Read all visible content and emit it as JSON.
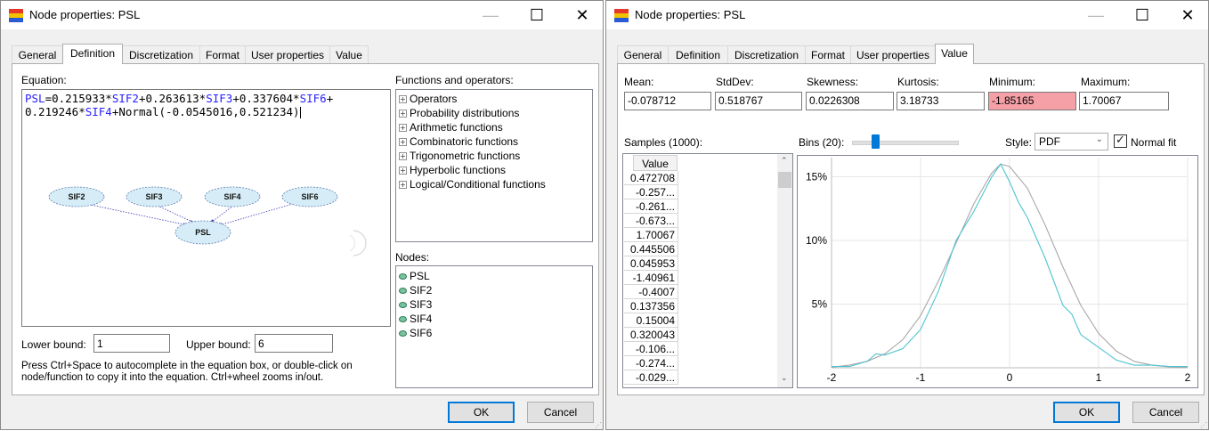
{
  "left_window": {
    "title": "Node properties: PSL",
    "controls": {
      "minimize": "—",
      "maximize": "☐",
      "close": "✕"
    },
    "tabs": [
      "General",
      "Definition",
      "Discretization",
      "Format",
      "User properties",
      "Value"
    ],
    "active_tab": "Definition",
    "equation_label": "Equation:",
    "equation_lines": [
      [
        {
          "t": "PSL",
          "k": true
        },
        {
          "t": "=0.215933*",
          "k": false
        },
        {
          "t": "SIF2",
          "k": true
        },
        {
          "t": "+0.263613*",
          "k": false
        },
        {
          "t": "SIF3",
          "k": true
        },
        {
          "t": "+0.337604*",
          "k": false
        },
        {
          "t": "SIF6",
          "k": true
        },
        {
          "t": "+",
          "k": false
        }
      ],
      [
        {
          "t": "0.219246*",
          "k": false
        },
        {
          "t": "SIF4",
          "k": true
        },
        {
          "t": "+Normal(-0.0545016,0.521234)",
          "k": false
        }
      ]
    ],
    "diagram_nodes": [
      "SIF2",
      "SIF3",
      "SIF4",
      "SIF6",
      "PSL"
    ],
    "functions_label": "Functions and operators:",
    "functions": [
      "Operators",
      "Probability distributions",
      "Arithmetic functions",
      "Combinatoric functions",
      "Trigonometric functions",
      "Hyperbolic functions",
      "Logical/Conditional functions"
    ],
    "nodes_label": "Nodes:",
    "nodes": [
      "PSL",
      "SIF2",
      "SIF3",
      "SIF4",
      "SIF6"
    ],
    "lower_bound_label": "Lower bound:",
    "lower_bound": "1",
    "upper_bound_label": "Upper bound:",
    "upper_bound": "6",
    "hint_line1": "Press Ctrl+Space to autocomplete in the equation box, or double-click on",
    "hint_line2": "node/function to copy it into the equation. Ctrl+wheel zooms in/out.",
    "ok": "OK",
    "cancel": "Cancel"
  },
  "right_window": {
    "title": "Node properties: PSL",
    "controls": {
      "minimize": "—",
      "maximize": "☐",
      "close": "✕"
    },
    "tabs": [
      "General",
      "Definition",
      "Discretization",
      "Format",
      "User properties",
      "Value"
    ],
    "active_tab": "Value",
    "stats": [
      {
        "label": "Mean:",
        "value": "-0.078712",
        "highlight": false
      },
      {
        "label": "StdDev:",
        "value": "0.518767",
        "highlight": false
      },
      {
        "label": "Skewness:",
        "value": "0.0226308",
        "highlight": false
      },
      {
        "label": "Kurtosis:",
        "value": "3.18733",
        "highlight": false
      },
      {
        "label": "Minimum:",
        "value": "-1.85165",
        "highlight": true
      },
      {
        "label": "Maximum:",
        "value": "1.70067",
        "highlight": false
      }
    ],
    "samples_label": "Samples (1000):",
    "samples_header": "Value",
    "samples": [
      "0.472708",
      "-0.257...",
      "-0.261...",
      "-0.673...",
      "1.70067",
      "0.445506",
      "0.045953",
      "-1.40961",
      "-0.4007",
      "0.137356",
      "0.15004",
      "0.320043",
      "-0.106...",
      "-0.274...",
      "-0.029..."
    ],
    "bins_label": "Bins (20):",
    "bins_slider_fraction": 0.2,
    "style_label": "Style:",
    "style_value": "PDF",
    "normal_fit_label": "Normal fit",
    "normal_fit_checked": true,
    "ok": "OK",
    "cancel": "Cancel",
    "colors": {
      "histogram": "#4cc3cf",
      "normal_fit": "#a8a8a8",
      "highlight": "#f5a0a6",
      "keyword": "#2a22ff"
    }
  },
  "chart_data": {
    "type": "line",
    "title": "",
    "xlabel": "",
    "ylabel": "",
    "xlim": [
      -2,
      2
    ],
    "ylim": [
      0,
      16.5
    ],
    "x_ticks": [
      -2,
      -1,
      0,
      1,
      2
    ],
    "y_ticks": [
      {
        "value": 5,
        "label": "5%"
      },
      {
        "value": 10,
        "label": "10%"
      },
      {
        "value": 15,
        "label": "15%"
      }
    ],
    "grid": true,
    "series": [
      {
        "x": [
          -2.0,
          -1.8,
          -1.6,
          -1.5,
          -1.4,
          -1.2,
          -1.0,
          -0.8,
          -0.6,
          -0.4,
          -0.2,
          -0.1,
          0.0,
          0.1,
          0.2,
          0.4,
          0.6,
          0.7,
          0.8,
          1.0,
          1.2,
          1.4,
          1.6,
          1.8,
          2.0
        ],
        "y": [
          0.1,
          0.1,
          0.5,
          1.1,
          1.0,
          1.5,
          3.0,
          6.0,
          10.0,
          12.3,
          15.0,
          16.0,
          14.6,
          13.0,
          11.8,
          8.6,
          4.9,
          4.2,
          2.6,
          1.6,
          0.6,
          0.2,
          0.2,
          0.1,
          0.1
        ]
      },
      {
        "x": [
          -2.0,
          -1.8,
          -1.6,
          -1.4,
          -1.2,
          -1.0,
          -0.8,
          -0.6,
          -0.4,
          -0.2,
          -0.1,
          0.0,
          0.2,
          0.4,
          0.6,
          0.8,
          1.0,
          1.2,
          1.4,
          1.6,
          1.8,
          2.0
        ],
        "y": [
          0.05,
          0.2,
          0.5,
          1.1,
          2.2,
          4.1,
          6.8,
          9.8,
          12.9,
          15.3,
          16.0,
          15.8,
          14.1,
          11.2,
          7.9,
          4.9,
          2.7,
          1.3,
          0.5,
          0.2,
          0.06,
          0.02
        ]
      }
    ]
  }
}
